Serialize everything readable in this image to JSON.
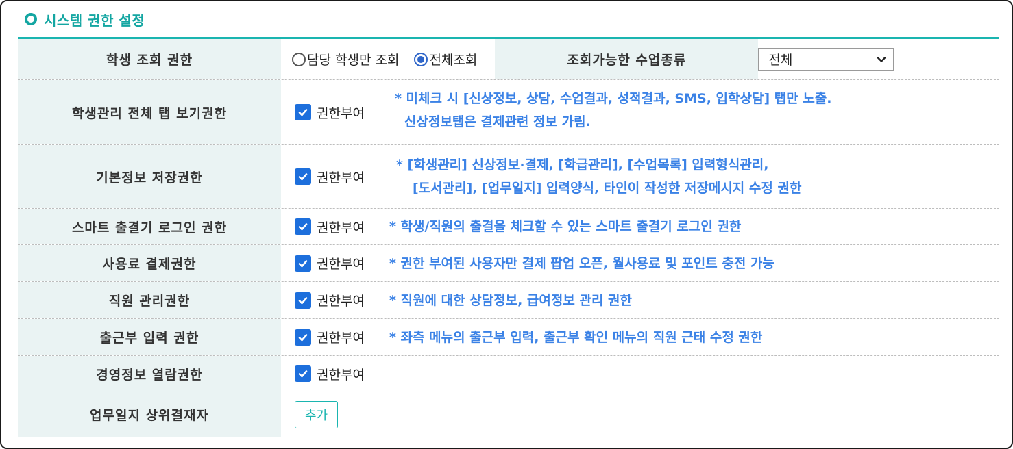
{
  "section": {
    "title": "시스템 권한 설정"
  },
  "rows": {
    "student_view": {
      "label": "학생 조회 권한",
      "options": [
        "담당 학생만 조회",
        "전체조회"
      ],
      "selected": "전체조회",
      "class_type_label": "조회가능한 수업종류",
      "class_type_value": "전체"
    },
    "tab_all": {
      "label": "학생관리 전체 탭 보기권한",
      "checkbox_label": "권한부여",
      "checked": true,
      "note_line1": "* 미체크 시 [신상정보, 상담, 수업결과, 성적결과, SMS, 입학상담] 탭만 노출.",
      "note_line2": "신상정보탭은 결제관련 정보 가림."
    },
    "basic_save": {
      "label": "기본정보 저장권한",
      "checkbox_label": "권한부여",
      "checked": true,
      "note_line1": "* [학생관리] 신상정보·결제, [학급관리], [수업목록] 입력형식관리,",
      "note_line2": "[도서관리], [업무일지] 입력양식, 타인이 작성한 저장메시지 수정 권한"
    },
    "smart_attendance": {
      "label": "스마트 출결기 로그인 권한",
      "checkbox_label": "권한부여",
      "checked": true,
      "note": "* 학생/직원의 출결을 체크할 수 있는 스마트 출결기 로그인 권한"
    },
    "fee_payment": {
      "label": "사용료 결제권한",
      "checkbox_label": "권한부여",
      "checked": true,
      "note": "* 권한 부여된 사용자만 결제 팝업 오픈, 월사용료 및 포인트 충전 가능"
    },
    "staff_manage": {
      "label": "직원 관리권한",
      "checkbox_label": "권한부여",
      "checked": true,
      "note": "* 직원에 대한 상담정보, 급여정보 관리 권한"
    },
    "attendance_input": {
      "label": "출근부 입력 권한",
      "checkbox_label": "권한부여",
      "checked": true,
      "note": "* 좌측 메뉴의 출근부 입력, 출근부 확인 메뉴의 직원 근태 수정 권한"
    },
    "management_view": {
      "label": "경영정보 열람권한",
      "checkbox_label": "권한부여",
      "checked": true
    },
    "work_log_approver": {
      "label": "업무일지 상위결재자",
      "add_button": "추가"
    }
  },
  "colors": {
    "accent": "#1ab5b0",
    "note_blue": "#3b82e6",
    "checkbox_blue": "#1d6fdc",
    "label_bg": "#eaf3f3"
  }
}
